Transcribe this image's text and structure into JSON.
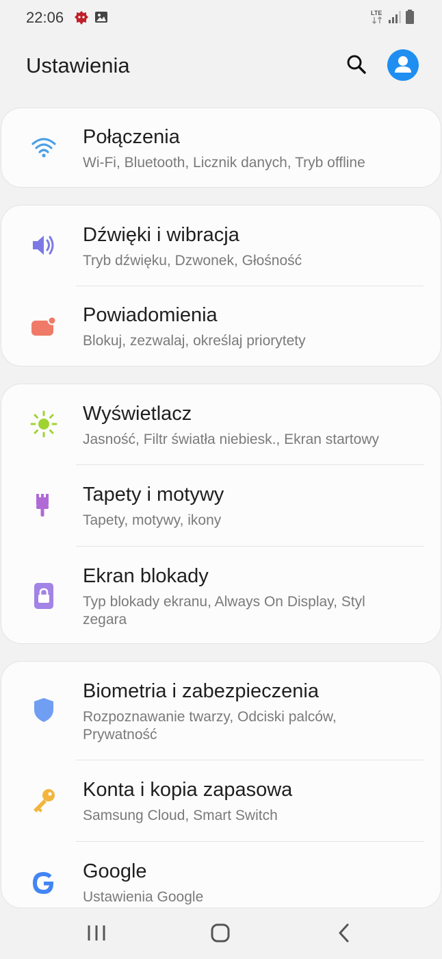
{
  "status_bar": {
    "time": "22:06",
    "network": "LTE",
    "icons": [
      "antutu-icon",
      "image-icon",
      "lte-data-icon",
      "signal-icon",
      "battery-icon"
    ]
  },
  "header": {
    "title": "Ustawienia",
    "actions": [
      "search-icon",
      "profile-icon"
    ]
  },
  "groups": [
    {
      "items": [
        {
          "icon": "wifi-icon",
          "color": "#4a9fe8",
          "title": "Połączenia",
          "subtitle": "Wi-Fi, Bluetooth, Licznik danych, Tryb offline"
        }
      ]
    },
    {
      "items": [
        {
          "icon": "speaker-icon",
          "color": "#7c79e6",
          "title": "Dźwięki i wibracja",
          "subtitle": "Tryb dźwięku, Dzwonek, Głośność"
        },
        {
          "icon": "notification-icon",
          "color": "#ef7a68",
          "title": "Powiadomienia",
          "subtitle": "Blokuj, zezwalaj, określaj priorytety"
        }
      ]
    },
    {
      "items": [
        {
          "icon": "brightness-icon",
          "color": "#9fd334",
          "title": "Wyświetlacz",
          "subtitle": "Jasność, Filtr światła niebiesk., Ekran startowy"
        },
        {
          "icon": "paint-brush-icon",
          "color": "#b06ad6",
          "title": "Tapety i motywy",
          "subtitle": "Tapety, motywy, ikony"
        },
        {
          "icon": "lock-icon",
          "color": "#a283e6",
          "title": "Ekran blokady",
          "subtitle": "Typ blokady ekranu, Always On Display, Styl zegara"
        }
      ]
    },
    {
      "items": [
        {
          "icon": "shield-icon",
          "color": "#6f9ef2",
          "title": "Biometria i zabezpieczenia",
          "subtitle": "Rozpoznawanie twarzy, Odciski palców, Prywatność"
        },
        {
          "icon": "key-icon",
          "color": "#f2b63c",
          "title": "Konta i kopia zapasowa",
          "subtitle": "Samsung Cloud, Smart Switch"
        },
        {
          "icon": "google-icon",
          "color": "#4285f4",
          "title": "Google",
          "subtitle": "Ustawienia Google"
        }
      ]
    }
  ],
  "nav_bar": {
    "buttons": [
      "recent-apps-icon",
      "home-icon",
      "back-icon"
    ]
  },
  "colors": {
    "background": "#f2f2f2",
    "card": "#fcfcfc",
    "accent": "#1f8ef1",
    "subtitle": "#7a7a7a"
  }
}
